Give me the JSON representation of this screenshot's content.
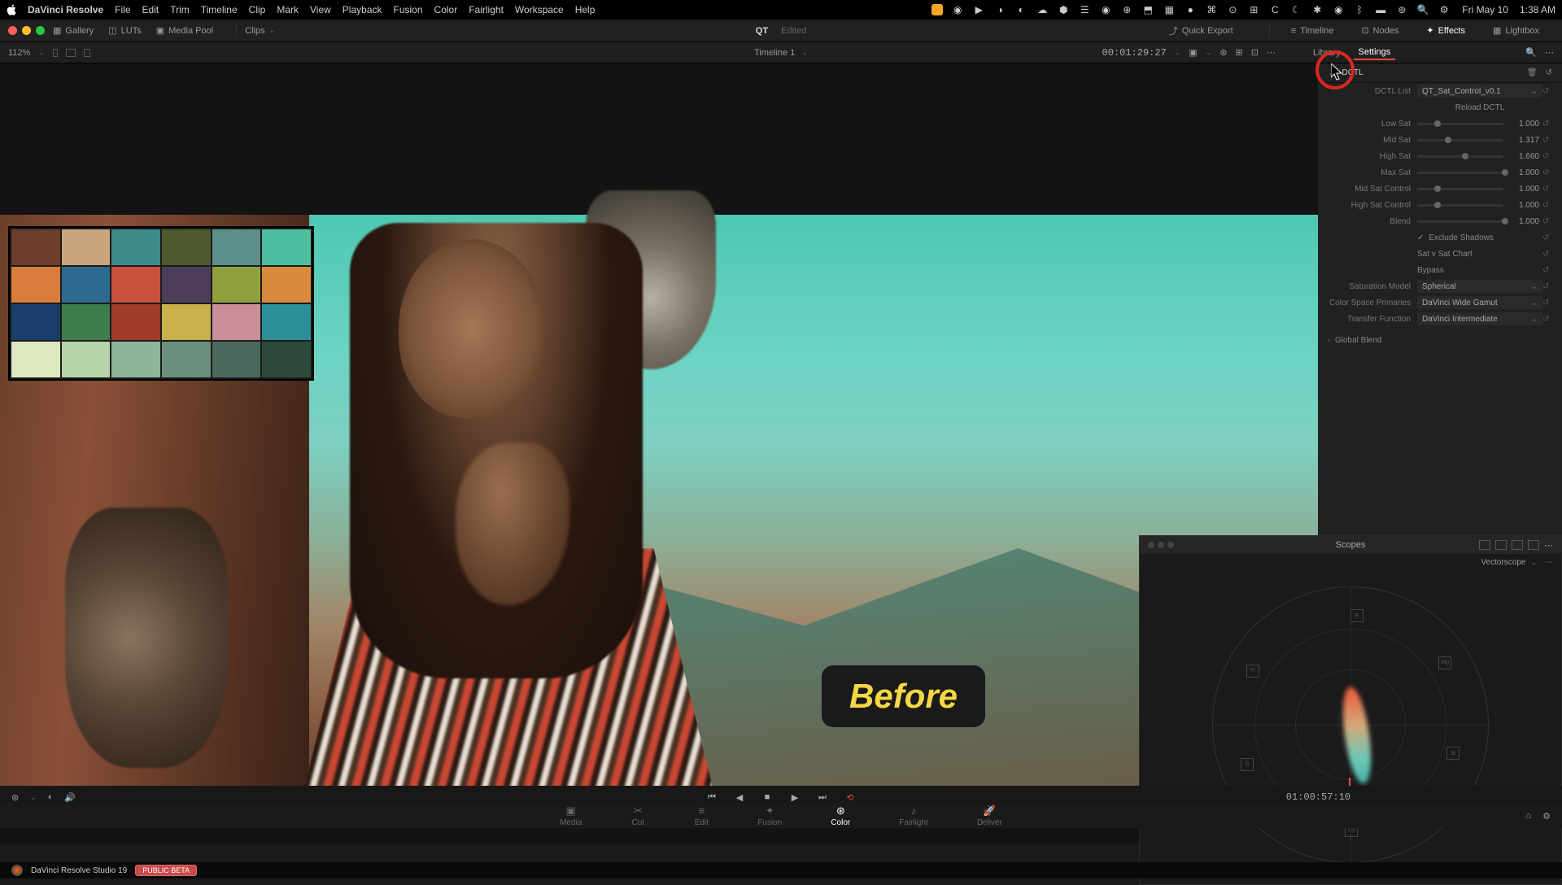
{
  "menubar": {
    "app": "DaVinci Resolve",
    "items": [
      "File",
      "Edit",
      "Trim",
      "Timeline",
      "Clip",
      "Mark",
      "View",
      "Playback",
      "Fusion",
      "Color",
      "Fairlight",
      "Workspace",
      "Help"
    ],
    "date": "Fri May 10",
    "time": "1:38 AM"
  },
  "topbar": {
    "gallery": "Gallery",
    "luts": "LUTs",
    "mediapool": "Media Pool",
    "clips": "Clips",
    "project": "QT",
    "status": "Edited",
    "quickexport": "Quick Export",
    "timeline": "Timeline",
    "nodes": "Nodes",
    "effects": "Effects",
    "lightbox": "Lightbox"
  },
  "secondbar": {
    "zoom": "112%",
    "timeline_name": "Timeline 1",
    "timecode": "00:01:29:27",
    "library": "Library",
    "settings": "Settings"
  },
  "dctl": {
    "title": "DCTL",
    "list_label": "DCTL List",
    "list_value": "QT_Sat_Control_v0.1",
    "reload": "Reload DCTL",
    "params": [
      {
        "label": "Low Sat",
        "value": "1.000",
        "pos": 20
      },
      {
        "label": "Mid Sat",
        "value": "1.317",
        "pos": 32
      },
      {
        "label": "High Sat",
        "value": "1.660",
        "pos": 52
      },
      {
        "label": "Max Sat",
        "value": "1.000",
        "pos": 98
      },
      {
        "label": "Mid Sat Control",
        "value": "1.000",
        "pos": 20
      },
      {
        "label": "High Sat Control",
        "value": "1.000",
        "pos": 20
      },
      {
        "label": "Blend",
        "value": "1.000",
        "pos": 98
      }
    ],
    "exclude_shadows": "Exclude Shadows",
    "sat_chart": "Sat v Sat Chart",
    "bypass": "Bypass",
    "sat_model_label": "Saturation Model",
    "sat_model_value": "Spherical",
    "cs_label": "Color Space Primaries",
    "cs_value": "DaVinci Wide Gamut",
    "tf_label": "Transfer Function",
    "tf_value": "DaVinci Intermediate",
    "global_blend": "Global Blend"
  },
  "scopes": {
    "title": "Scopes",
    "type": "Vectorscope",
    "targets": [
      "R",
      "Mg",
      "B",
      "Cy",
      "G",
      "Yl"
    ]
  },
  "viewer": {
    "overlay_text": "Before",
    "colorchart": [
      "#6b3d2a",
      "#c9a47d",
      "#3d8a8a",
      "#4d5a2d",
      "#5d8f8a",
      "#4dbfa0",
      "#d97d3d",
      "#2d6a8f",
      "#c9503d",
      "#4d3d5a",
      "#8fa03d",
      "#d98a3d",
      "#1a3d6a",
      "#3d7d4a",
      "#a03d2a",
      "#c9b04a",
      "#c98f9a",
      "#2d8f9a",
      "#dde8c0",
      "#b5d4a8",
      "#8fb59a",
      "#6a8f7d",
      "#4a6a5d",
      "#2d4a3d"
    ]
  },
  "transport": {
    "timecode": "01:00:57:10"
  },
  "pages": {
    "items": [
      "Media",
      "Cut",
      "Edit",
      "Fusion",
      "Color",
      "Fairlight",
      "Deliver"
    ],
    "active": "Color"
  },
  "footer": {
    "app": "DaVinci Resolve Studio 19",
    "badge": "PUBLIC BETA"
  }
}
